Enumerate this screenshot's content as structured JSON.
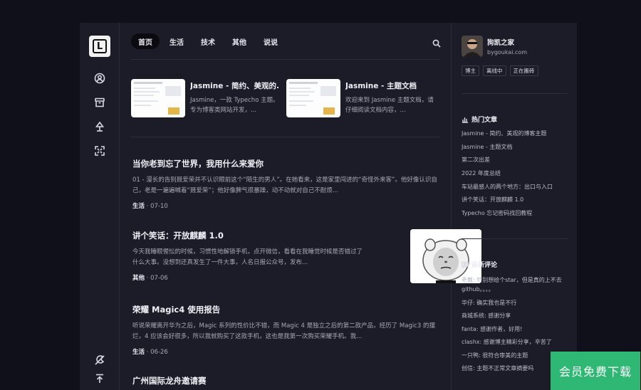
{
  "nav": {
    "tabs": [
      {
        "label": "首页",
        "active": true
      },
      {
        "label": "生活",
        "active": false
      },
      {
        "label": "技术",
        "active": false
      },
      {
        "label": "其他",
        "active": false
      },
      {
        "label": "说说",
        "active": false
      }
    ],
    "search_icon": "search-icon"
  },
  "rail": {
    "logo_letter": "L",
    "icons": [
      "user-circle-icon",
      "archive-icon",
      "tree-icon",
      "fullscreen-icon",
      "theme-toggle-icon",
      "back-to-top-icon"
    ]
  },
  "featured": [
    {
      "title": "Jasmine - 简约、美观的...",
      "desc": "Jasmine，一款 Typecho 主题。专为博客类网站开发，..."
    },
    {
      "title": "Jasmine - 主题文档",
      "desc": "欢迎来到 Jasmine 主题文档，请仔细阅读文档内容，..."
    }
  ],
  "posts": [
    {
      "title": "当你老到忘了世界，我用什么来爱你",
      "excerpt": "01 - 漫长的告别聂爱荣并不认识眼前这个“陌生的男人”。在她看来，这是家里闯进的“奇怪外来客”。他好像认识自己，老是一遍遍喊着“聂爱荣”；他好像脾气很暴躁，动不动就对自己不耐烦...",
      "category": "生活",
      "date": "· 07-10"
    },
    {
      "title": "讲个笑话：开放麒麟 1.0",
      "excerpt": "今天我睡眼惺忪的时候，习惯性地解锁手机，点开微信，看看在我睡觉时候是否错过了什么大事。没想到还真发生了一件大事，人名日报公众号，发布...",
      "category": "其他",
      "date": "· 07-06"
    },
    {
      "title": "荣耀 Magic4 使用报告",
      "excerpt": "听说荣耀离开华为之后，Magic 系列的性价比不错，而 Magic 4 是独立之后的第二款产品，经历了 Magic3 的摆烂，4 应该会好很多，所以我就购买了这款手机，这也是我第一次购买荣耀手机。我...",
      "category": "生活",
      "date": "· 06-26"
    },
    {
      "title": "广州国际龙舟邀请赛"
    }
  ],
  "author": {
    "name": "狗凯之家",
    "site": "bygoukai.com",
    "tags": [
      "博主",
      "离线中",
      "正在搬砖"
    ]
  },
  "hot": {
    "heading": "热门文章",
    "items": [
      "Jasmine - 简约、美观的博客主题",
      "Jasmine - 主题文档",
      "第二次出差",
      "2022 年度总结",
      "车站最感人的两个地方：出口与入口",
      "讲个笑话：开放麒麟 1.0",
      "Typecho 忘记密码找回教程"
    ]
  },
  "comments": {
    "heading": "最新评论",
    "items": [
      "老戴: 特别想给个star，但是真的上不去github。。。。",
      "华仔: 确实我也是不行",
      "商城系统: 感谢分享",
      "fanta: 感谢作者，好用!",
      "clashx: 感谢博主精彩分享，辛苦了",
      "一只鸭: 很符合审美的主题",
      "创信: 主题不正常文章摘要吗"
    ]
  },
  "watermark": "会员免费下载",
  "colors": {
    "page_bg": "#0f1019",
    "panel_bg": "#1b1c28",
    "watermark_bg": "#2eb873"
  }
}
